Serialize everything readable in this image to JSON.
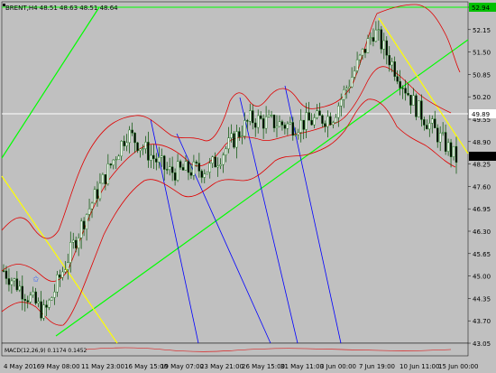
{
  "header": {
    "symbol_info": "BRENT,H4  48.51 48.63 48.51 48.64"
  },
  "indicator": {
    "label": "MACD(12,26,9) 0.1174 0.1452"
  },
  "price_axis": {
    "labels": [
      "52.94",
      "52.15",
      "51.50",
      "50.85",
      "50.20",
      "49.55",
      "48.90",
      "48.25",
      "47.60",
      "46.95",
      "46.30",
      "45.65",
      "45.00",
      "44.35",
      "43.70",
      "43.05"
    ],
    "current_price": "48.64",
    "top_price": "52.94",
    "level_price": "49.89"
  },
  "time_axis": {
    "labels": [
      "4 May 2016",
      "9 May 08:00",
      "11 May 23:00",
      "16 May 15:00",
      "19 May 07:00",
      "23 May 21:00",
      "26 May 15:00",
      "31 May 11:00",
      "3 Jun 00:00",
      "7 Jun 19:00",
      "10 Jun 11:00",
      "15 Jun 00:00"
    ]
  },
  "colors": {
    "background": "#c0c0c0",
    "bollinger": "#e00000",
    "trendline_green": "#00ff00",
    "trendline_yellow": "#ffff00",
    "fan_lines": "#0000ff",
    "candles": "#006400",
    "price_tag_green": "#00c000",
    "price_tag_current": "#000000"
  },
  "chart_data": {
    "type": "candlestick",
    "title": "BRENT,H4",
    "ylim": [
      43.0,
      53.2
    ],
    "x": [
      "4 May 2016",
      "9 May 08:00",
      "11 May 23:00",
      "16 May 15:00",
      "19 May 07:00",
      "23 May 21:00",
      "26 May 15:00",
      "31 May 11:00",
      "3 Jun 00:00",
      "7 Jun 19:00",
      "10 Jun 11:00",
      "15 Jun 00:00"
    ],
    "close_approx": [
      45.2,
      43.9,
      46.9,
      49.4,
      48.2,
      48.3,
      49.8,
      49.6,
      49.9,
      52.5,
      50.2,
      48.6
    ]
  }
}
